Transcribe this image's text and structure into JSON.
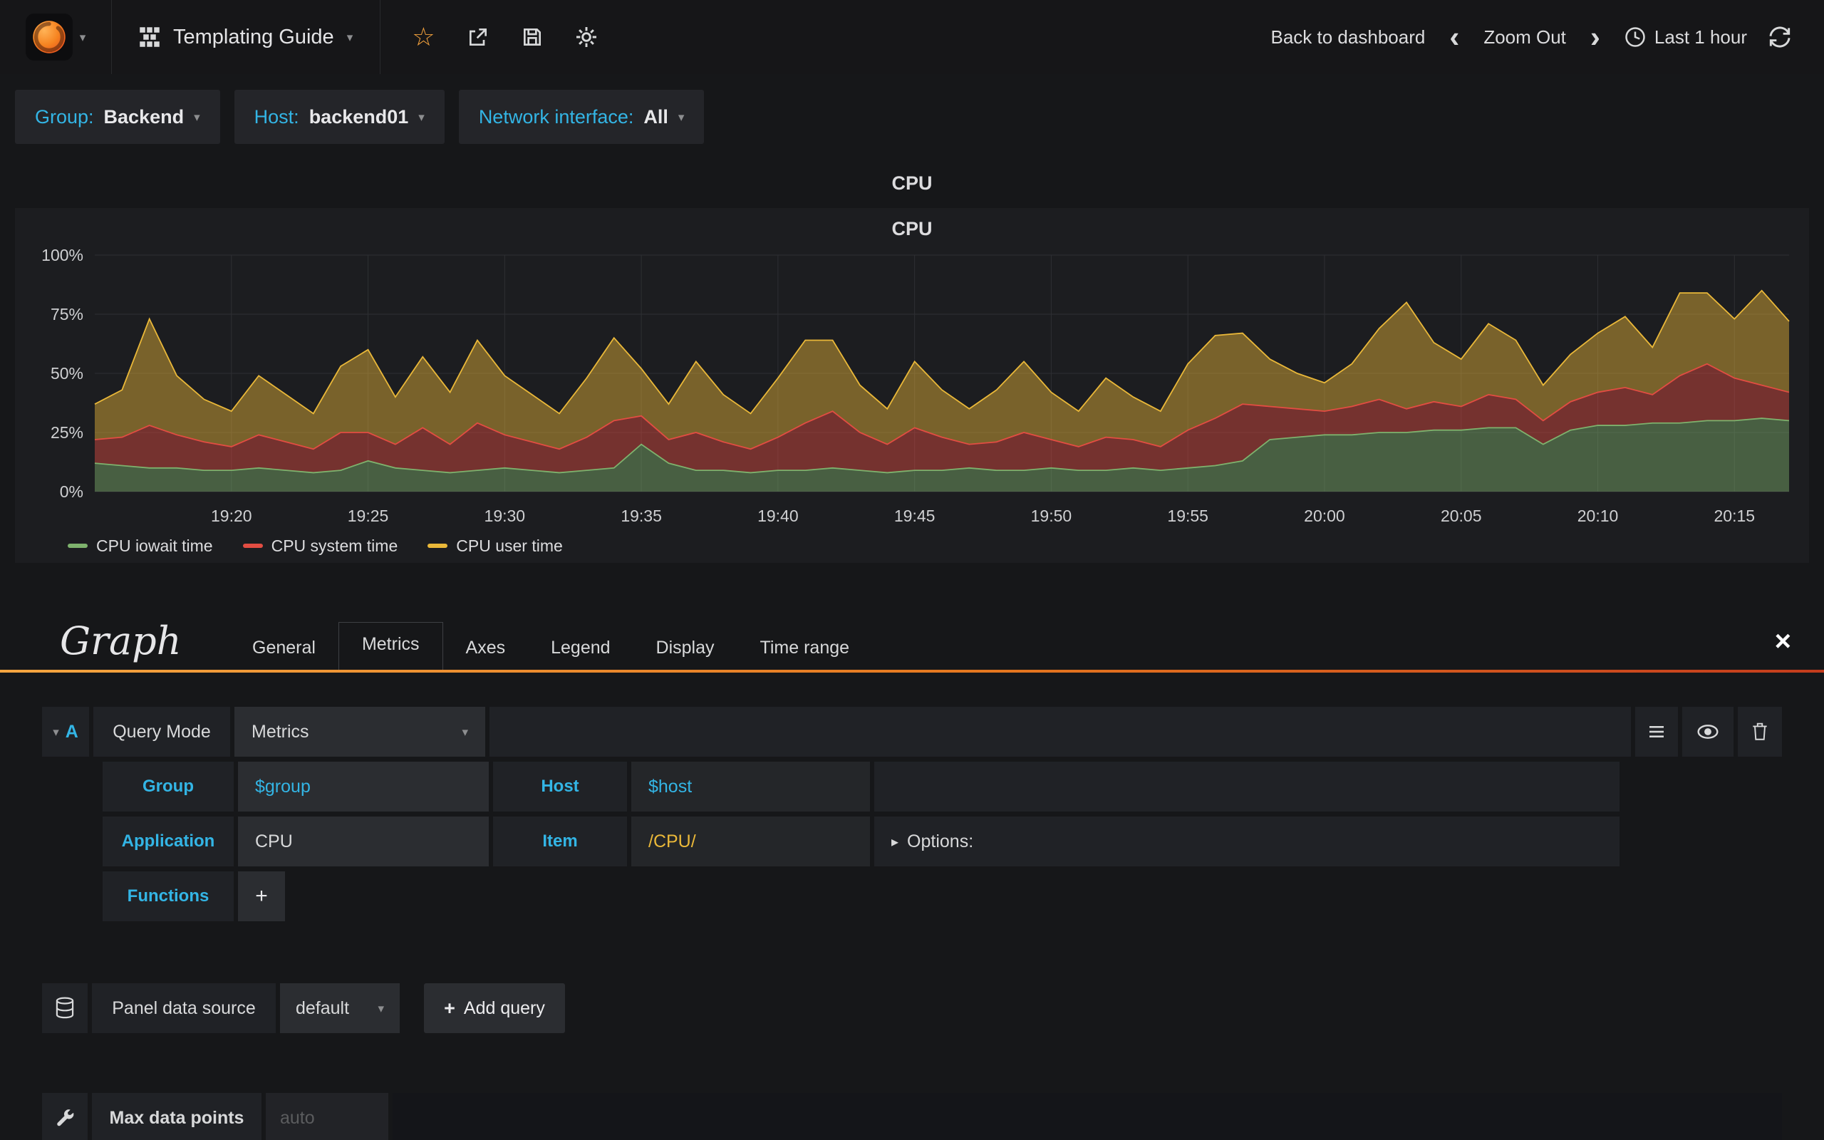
{
  "navbar": {
    "title": "Templating Guide",
    "back_to_dashboard": "Back to dashboard",
    "zoom_out": "Zoom Out",
    "time_range": "Last 1 hour"
  },
  "icons": {
    "caret_down": "▾",
    "chevron_left": "‹",
    "chevron_right": "›",
    "star": "☆",
    "close": "×",
    "options_arrow": "▸",
    "plus": "+"
  },
  "template_vars": [
    {
      "label": "Group:",
      "value": "Backend"
    },
    {
      "label": "Host:",
      "value": "backend01"
    },
    {
      "label": "Network interface:",
      "value": "All"
    }
  ],
  "panel": {
    "header_title": "CPU",
    "chart_title": "CPU"
  },
  "chart_data": {
    "type": "area",
    "stacked": true,
    "title": "CPU",
    "ylabel": "",
    "ylim": [
      0,
      100
    ],
    "yticks": [
      "0%",
      "25%",
      "50%",
      "75%",
      "100%"
    ],
    "x_start": "19:15",
    "x_end": "20:17",
    "x_step_minutes": 1,
    "xtick_positions": [
      5,
      10,
      15,
      20,
      25,
      30,
      35,
      40,
      45,
      50,
      55,
      60
    ],
    "xtick_labels": [
      "19:20",
      "19:25",
      "19:30",
      "19:35",
      "19:40",
      "19:45",
      "19:50",
      "19:55",
      "20:00",
      "20:05",
      "20:10",
      "20:15"
    ],
    "grid": true,
    "legend_position": "bottom-left",
    "series": [
      {
        "name": "CPU iowait time",
        "color": "#7EB26D",
        "values": [
          12,
          11,
          10,
          10,
          9,
          9,
          10,
          9,
          8,
          9,
          13,
          10,
          9,
          8,
          9,
          10,
          9,
          8,
          9,
          10,
          20,
          12,
          9,
          9,
          8,
          9,
          9,
          10,
          9,
          8,
          9,
          9,
          10,
          9,
          9,
          10,
          9,
          9,
          10,
          9,
          10,
          11,
          13,
          22,
          23,
          24,
          24,
          25,
          25,
          26,
          26,
          27,
          27,
          20,
          26,
          28,
          28,
          29,
          29,
          30,
          30,
          31,
          30
        ]
      },
      {
        "name": "CPU system time",
        "color": "#E24D42",
        "values": [
          10,
          12,
          18,
          14,
          12,
          10,
          14,
          12,
          10,
          16,
          12,
          10,
          18,
          12,
          20,
          14,
          12,
          10,
          14,
          20,
          12,
          10,
          16,
          12,
          10,
          14,
          20,
          24,
          16,
          12,
          18,
          14,
          10,
          12,
          16,
          12,
          10,
          14,
          12,
          10,
          16,
          20,
          24,
          14,
          12,
          10,
          12,
          14,
          10,
          12,
          10,
          14,
          12,
          10,
          12,
          14,
          16,
          12,
          20,
          24,
          18,
          14,
          12
        ]
      },
      {
        "name": "CPU user time",
        "color": "#EAB839",
        "values": [
          15,
          20,
          45,
          25,
          18,
          15,
          25,
          20,
          15,
          28,
          35,
          20,
          30,
          22,
          35,
          25,
          20,
          15,
          25,
          35,
          20,
          15,
          30,
          20,
          15,
          25,
          35,
          30,
          20,
          15,
          28,
          20,
          15,
          22,
          30,
          20,
          15,
          25,
          18,
          15,
          28,
          35,
          30,
          20,
          15,
          12,
          18,
          30,
          45,
          25,
          20,
          30,
          25,
          15,
          20,
          25,
          30,
          20,
          35,
          30,
          25,
          40,
          30
        ]
      }
    ]
  },
  "editor": {
    "panel_type_title": "Graph",
    "tabs": [
      "General",
      "Metrics",
      "Axes",
      "Legend",
      "Display",
      "Time range"
    ],
    "active_tab": "Metrics",
    "query": {
      "ref_letter": "A",
      "mode_label": "Query Mode",
      "mode_value": "Metrics",
      "group_label": "Group",
      "group_value": "$group",
      "host_label": "Host",
      "host_value": "$host",
      "application_label": "Application",
      "application_value": "CPU",
      "item_label": "Item",
      "item_value": "/CPU/",
      "options_label": "Options:",
      "functions_label": "Functions"
    },
    "datasource": {
      "label": "Panel data source",
      "value": "default",
      "add_query_label": "Add query"
    },
    "max_data_points": {
      "label": "Max data points",
      "placeholder": "auto"
    }
  },
  "colors": {
    "accent_cyan": "#33B5E5",
    "accent_orange": "#F2A13C",
    "page_bg": "#161719",
    "panel_bg": "#1C1D20"
  }
}
